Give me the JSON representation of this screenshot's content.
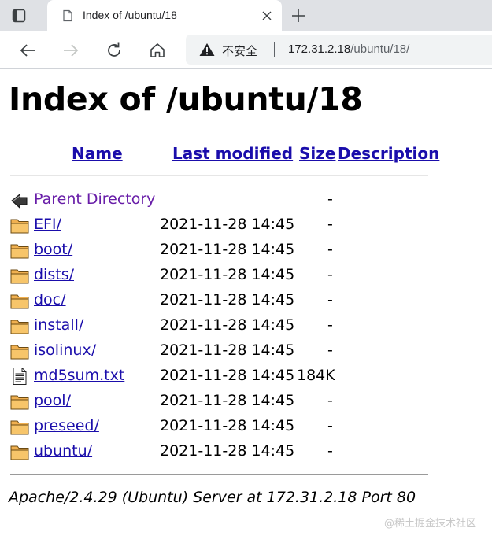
{
  "browser": {
    "tab_title": "Index of /ubuntu/18",
    "insecure_label": "不安全",
    "url_host": "172.31.2.18",
    "url_path": "/ubuntu/18/"
  },
  "page": {
    "title": "Index of /ubuntu/18",
    "columns": {
      "name": "Name",
      "last_modified": "Last modified",
      "size": "Size",
      "description": "Description"
    },
    "entries": [
      {
        "icon": "back-icon",
        "name": "Parent Directory",
        "modified": "",
        "size": "-",
        "visited": true
      },
      {
        "icon": "folder-icon",
        "name": "EFI/",
        "modified": "2021-11-28 14:45",
        "size": "-"
      },
      {
        "icon": "folder-icon",
        "name": "boot/",
        "modified": "2021-11-28 14:45",
        "size": "-"
      },
      {
        "icon": "folder-icon",
        "name": "dists/",
        "modified": "2021-11-28 14:45",
        "size": "-"
      },
      {
        "icon": "folder-icon",
        "name": "doc/",
        "modified": "2021-11-28 14:45",
        "size": "-"
      },
      {
        "icon": "folder-icon",
        "name": "install/",
        "modified": "2021-11-28 14:45",
        "size": "-"
      },
      {
        "icon": "folder-icon",
        "name": "isolinux/",
        "modified": "2021-11-28 14:45",
        "size": "-"
      },
      {
        "icon": "text-file-icon",
        "name": "md5sum.txt",
        "modified": "2021-11-28 14:45",
        "size": "184K"
      },
      {
        "icon": "folder-icon",
        "name": "pool/",
        "modified": "2021-11-28 14:45",
        "size": "-"
      },
      {
        "icon": "folder-icon",
        "name": "preseed/",
        "modified": "2021-11-28 14:45",
        "size": "-"
      },
      {
        "icon": "folder-icon",
        "name": "ubuntu/",
        "modified": "2021-11-28 14:45",
        "size": "-"
      }
    ],
    "server_signature": "Apache/2.4.29 (Ubuntu) Server at 172.31.2.18 Port 80"
  },
  "watermark": "@稀土掘金技术社区",
  "colors": {
    "link": "#1a0dab",
    "visited_link": "#681da8",
    "folder_fill": "#f0b050",
    "chrome_bg": "#dfe1e5"
  }
}
